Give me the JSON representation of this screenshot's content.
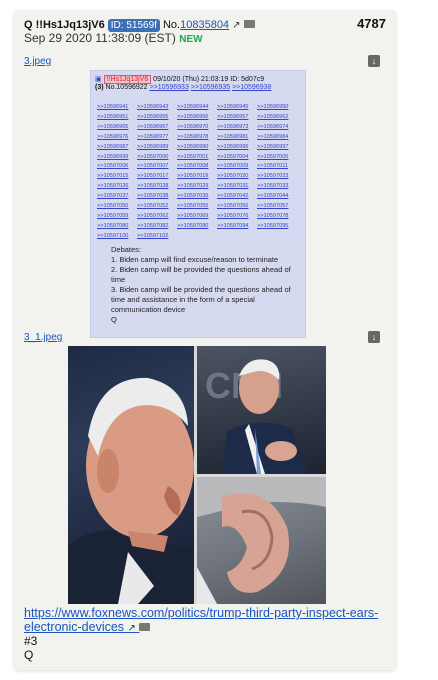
{
  "header": {
    "author": "Q !!Hs1Jq13jV6",
    "id_label": "ID: 51569f",
    "no_prefix": "No.",
    "post_no": "10835804",
    "count": "4787",
    "date": "Sep 29 2020 11:38:09 (EST)",
    "new_label": "NEW"
  },
  "files": [
    {
      "name": "3.jpeg"
    },
    {
      "name": "3_1.jpeg"
    }
  ],
  "screenshot": {
    "tag": "!!Hs1Jq13jV6",
    "date": "09/10/20 (Thu) 21:03:19",
    "id": "ID: 5d07c9",
    "count": "(3)",
    "no": "No.10596922",
    "links_first_line": [
      ">>10596933",
      ">>10596935",
      ">>10596938"
    ],
    "quote_ids": [
      ">>10596941",
      ">>10596943",
      ">>10596944",
      ">>10596945",
      ">>10596950",
      ">>10596951",
      ">>10596955",
      ">>10596956",
      ">>10596957",
      ">>10596962",
      ">>10596965",
      ">>10596967",
      ">>10596970",
      ">>10596973",
      ">>10596974",
      ">>10596976",
      ">>10596977",
      ">>10596978",
      ">>10596981",
      ">>10596984",
      ">>10596987",
      ">>10596989",
      ">>10596990",
      ">>10596996",
      ">>10596997",
      ">>10596999",
      ">>10597000",
      ">>10597001",
      ">>10597004",
      ">>10597005",
      ">>10597006",
      ">>10597007",
      ">>10597008",
      ">>10597009",
      ">>10597011",
      ">>10597015",
      ">>10597017",
      ">>10597019",
      ">>10597020",
      ">>10597023",
      ">>10597026",
      ">>10597028",
      ">>10597029",
      ">>10597031",
      ">>10597033",
      ">>10597037",
      ">>10597038",
      ">>10597039",
      ">>10597042",
      ">>10597044",
      ">>10597050",
      ">>10597052",
      ">>10597055",
      ">>10597056",
      ">>10597057",
      ">>10597059",
      ">>10597062",
      ">>10597069",
      ">>10597076",
      ">>10597078",
      ">>10597080",
      ">>10597082",
      ">>10597090",
      ">>10597094",
      ">>10597095",
      ">>10597100",
      ">>10597102"
    ],
    "body_lines": [
      "Debates:",
      "1. Biden camp will find excuse/reason to terminate",
      "2. Biden camp will be provided the questions ahead of time",
      "3. Biden camp will be provided the questions ahead of time and assistance in the form of a special communication device",
      "Q"
    ]
  },
  "collage_text": {
    "cnn_logo": "CNN"
  },
  "link": "https://www.foxnews.com/politics/trump-third-party-inspect-ears-electronic-devices",
  "tail_lines": [
    "#3",
    "Q"
  ],
  "colors": {
    "link": "#1a55c0",
    "new": "#1da750",
    "id_badge": "#3b6fb6"
  }
}
